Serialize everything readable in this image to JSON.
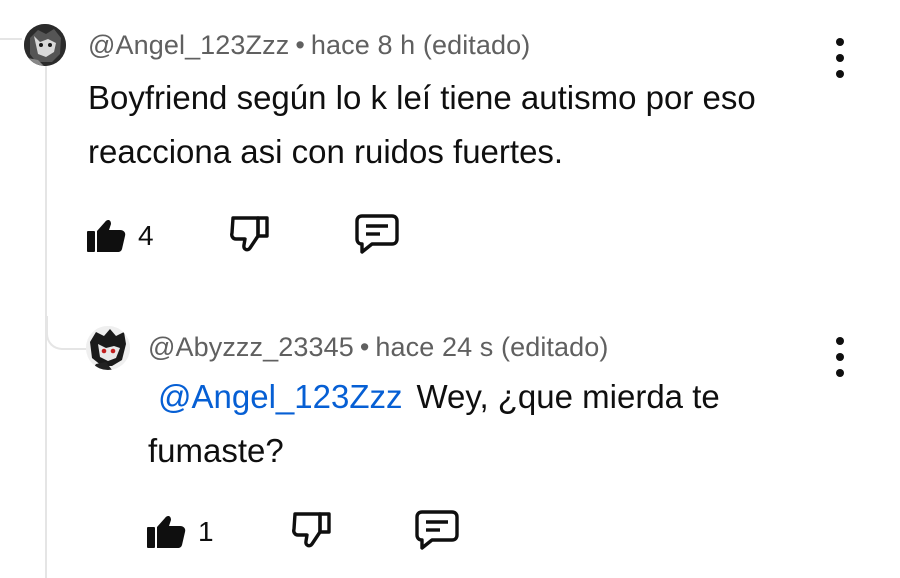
{
  "comment": {
    "author": "@Angel_123Zzz",
    "separator": "•",
    "time": "hace 8 h (editado)",
    "text_line1": "Boyfriend según lo k leí tiene autismo por eso",
    "text_line2": "reacciona asi con ruidos fuertes.",
    "like_count": "4",
    "avatar_icon": "dark-character-avatar",
    "like_icon": "thumbs-up-filled-icon",
    "dislike_icon": "thumbs-down-outline-icon",
    "reply_icon": "comment-reply-icon",
    "menu_icon": "more-vert-icon"
  },
  "reply": {
    "author": "@Abyzzz_23345",
    "separator": "•",
    "time": "hace 24 s (editado)",
    "mention": "@Angel_123Zzz",
    "text_line1": "Wey, ¿que mierda te",
    "text_line2": "fumaste?",
    "like_count": "1",
    "avatar_icon": "anime-character-avatar",
    "like_icon": "thumbs-up-filled-icon",
    "dislike_icon": "thumbs-down-outline-icon",
    "reply_icon": "comment-reply-icon",
    "menu_icon": "more-vert-icon"
  },
  "colors": {
    "text": "#0f0f0f",
    "meta": "#606060",
    "mention": "#065fd4",
    "thread_line": "#e5e5e5"
  }
}
